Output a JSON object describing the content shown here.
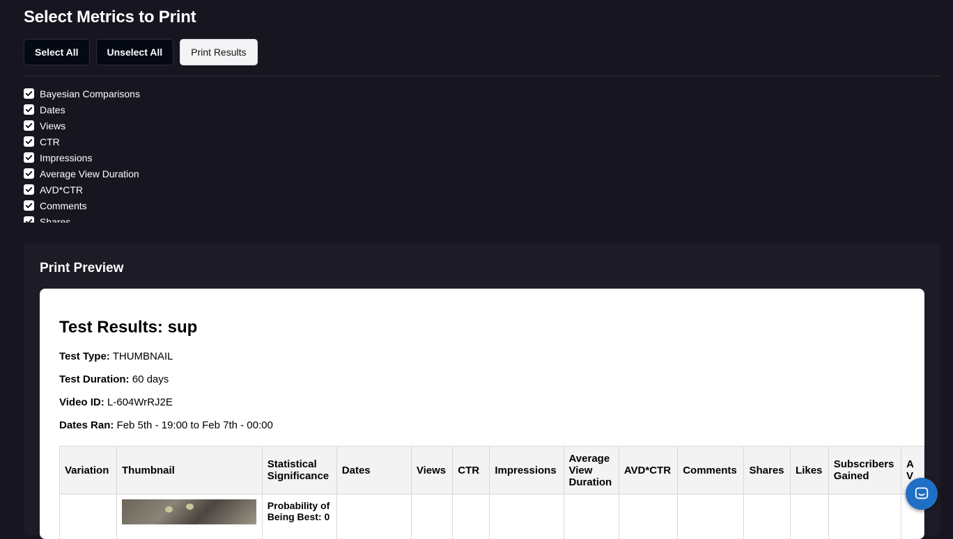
{
  "header": {
    "title": "Select Metrics to Print",
    "buttons": {
      "select_all": "Select All",
      "unselect_all": "Unselect All",
      "print": "Print Results"
    }
  },
  "metrics": [
    {
      "label": "Bayesian Comparisons",
      "checked": true
    },
    {
      "label": "Dates",
      "checked": true
    },
    {
      "label": "Views",
      "checked": true
    },
    {
      "label": "CTR",
      "checked": true
    },
    {
      "label": "Impressions",
      "checked": true
    },
    {
      "label": "Average View Duration",
      "checked": true
    },
    {
      "label": "AVD*CTR",
      "checked": true
    },
    {
      "label": "Comments",
      "checked": true
    },
    {
      "label": "Shares",
      "checked": true
    }
  ],
  "preview": {
    "heading": "Print Preview",
    "doc_title": "Test Results: sup",
    "test_type_label": "Test Type:",
    "test_type": "THUMBNAIL",
    "duration_label": "Test Duration:",
    "duration": "60 days",
    "video_id_label": "Video ID:",
    "video_id": "L-604WrRJ2E",
    "dates_label": "Dates Ran:",
    "dates": "Feb 5th - 19:00 to Feb 7th - 00:00"
  },
  "table": {
    "columns": [
      "Variation",
      "Thumbnail",
      "Statistical Significance",
      "Dates",
      "Views",
      "CTR",
      "Impressions",
      "Average View Duration",
      "AVD*CTR",
      "Comments",
      "Shares",
      "Likes",
      "Subscribers Gained",
      "A V"
    ],
    "row1": {
      "significance": "Probability of Being Best: 0"
    }
  },
  "colors": {
    "background": "#17151f",
    "panel": "#1d1b25",
    "chat": "#1f6fc4"
  },
  "icons": {
    "checkbox": "check-icon",
    "chat": "chat-bubble-icon"
  }
}
